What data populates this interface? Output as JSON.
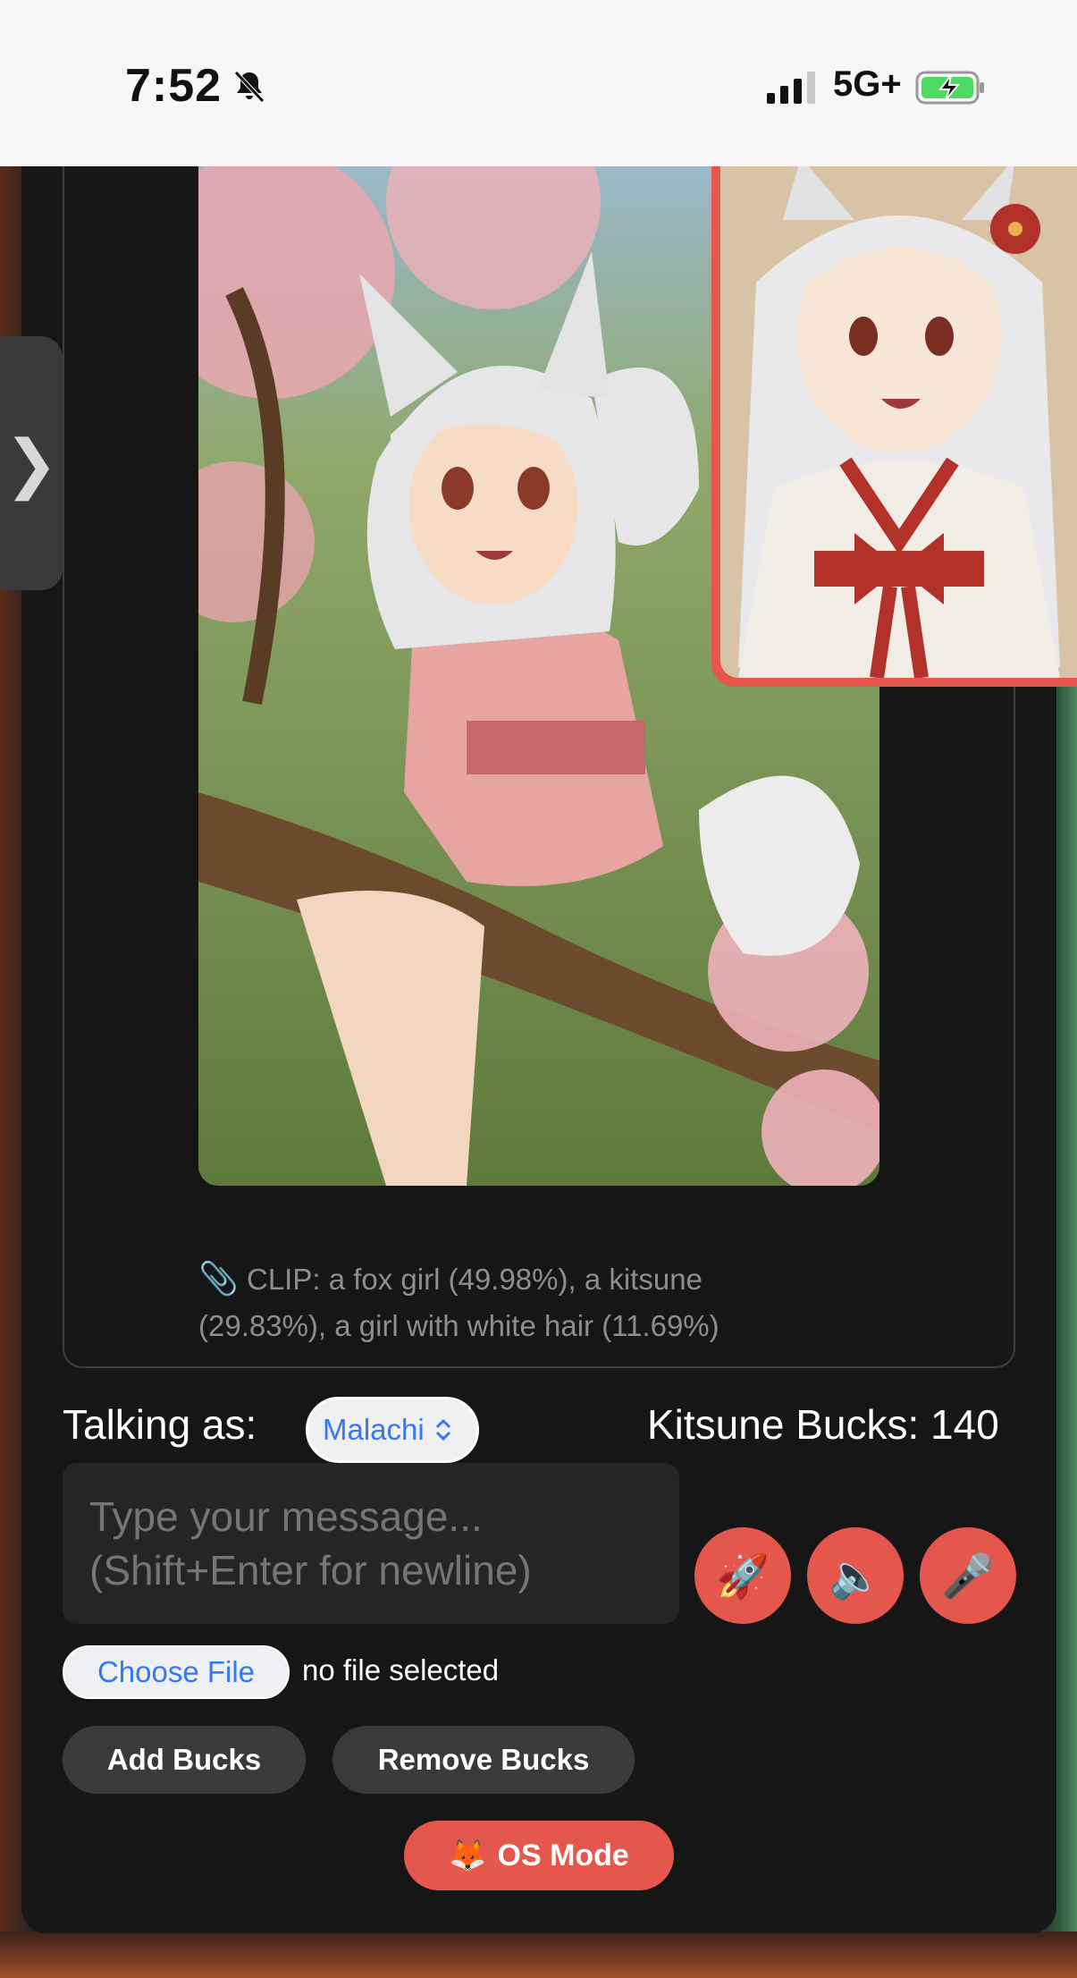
{
  "status_bar": {
    "time": "7:52",
    "network": "5G+"
  },
  "icons": {
    "bell": "bell-slash-icon",
    "signal": "signal-icon",
    "battery": "battery-charging-icon",
    "side_tab": "chevron-right-icon",
    "clip": "paperclip-icon",
    "rocket": "rocket-icon",
    "speaker": "speaker-icon",
    "mic": "microphone-icon",
    "os": "fox-icon"
  },
  "side_tab": {
    "glyph": "❯"
  },
  "clip": {
    "icon_glyph": "📎",
    "text": "CLIP: a fox girl (49.98%), a kitsune (29.83%), a girl with white hair (11.69%)"
  },
  "chat": {
    "talking_as_label": "Talking as:",
    "selected_user": "Malachi",
    "kitsune_bucks": "Kitsune Bucks: 140",
    "message_placeholder": "Type your message...\n(Shift+Enter for newline)",
    "rocket_glyph": "🚀",
    "speaker_glyph": "🔈",
    "mic_glyph": "🎤"
  },
  "file": {
    "choose_label": "Choose File",
    "status": "no file selected"
  },
  "buttons": {
    "add_bucks": "Add Bucks",
    "remove_bucks": "Remove Bucks",
    "os_mode_icon": "🦊",
    "os_mode": "OS Mode"
  },
  "colors": {
    "accent": "#e5574c",
    "panel": "#161617",
    "link_blue": "#3478f6"
  }
}
